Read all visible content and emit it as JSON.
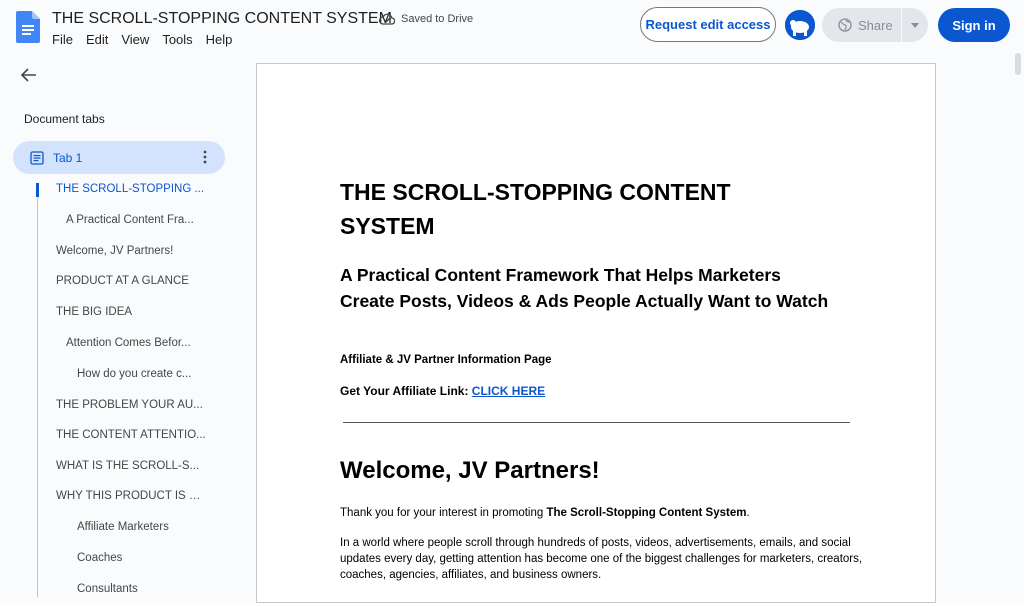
{
  "header": {
    "title": "THE SCROLL-STOPPING CONTENT SYSTEM",
    "saved_status": "Saved to Drive",
    "menu": [
      "File",
      "Edit",
      "View",
      "Tools",
      "Help"
    ],
    "request_edit_label": "Request edit access",
    "share_label": "Share",
    "signin_label": "Sign in"
  },
  "sidebar": {
    "title": "Document tabs",
    "tab_label": "Tab 1",
    "outline": [
      {
        "label": "THE SCROLL-STOPPING ...",
        "level": 1,
        "active": true
      },
      {
        "label": "A Practical Content Fra...",
        "level": 2,
        "active": false
      },
      {
        "label": "Welcome, JV Partners!",
        "level": 1,
        "active": false
      },
      {
        "label": "PRODUCT AT A GLANCE",
        "level": 1,
        "active": false
      },
      {
        "label": "THE BIG IDEA",
        "level": 1,
        "active": false
      },
      {
        "label": "Attention Comes Befor...",
        "level": 2,
        "active": false
      },
      {
        "label": "How do you create c...",
        "level": 3,
        "active": false
      },
      {
        "label": "THE PROBLEM YOUR AU...",
        "level": 1,
        "active": false
      },
      {
        "label": "THE CONTENT ATTENTIO...",
        "level": 1,
        "active": false
      },
      {
        "label": "WHAT IS THE SCROLL-S...",
        "level": 1,
        "active": false
      },
      {
        "label": "WHY THIS PRODUCT IS E...",
        "level": 1,
        "active": false
      },
      {
        "label": "Affiliate Marketers",
        "level": 3,
        "active": false
      },
      {
        "label": "Coaches",
        "level": 3,
        "active": false
      },
      {
        "label": "Consultants",
        "level": 3,
        "active": false
      }
    ]
  },
  "document": {
    "h1": "THE SCROLL-STOPPING CONTENT SYSTEM",
    "h2": "A Practical Content Framework That Helps Marketers Create Posts, Videos & Ads People Actually Want to Watch",
    "affiliate_heading": "Affiliate & JV Partner Information Page",
    "link_prefix": "Get Your Affiliate Link: ",
    "link_text": "CLICK HERE",
    "welcome": "Welcome, JV Partners!",
    "thanks_prefix": "Thank you for your interest in promoting ",
    "thanks_bold": "The Scroll-Stopping Content System",
    "thanks_suffix": ".",
    "world_para": "In a world where people scroll through hundreds of posts, videos, advertisements, emails, and social updates every day, getting attention has become one of the biggest challenges for marketers, creators, coaches, agencies, affiliates, and business owners."
  },
  "colors": {
    "accent": "#0b57d0",
    "active_tab_bg": "#d3e3fd",
    "link": "#1155cc"
  }
}
